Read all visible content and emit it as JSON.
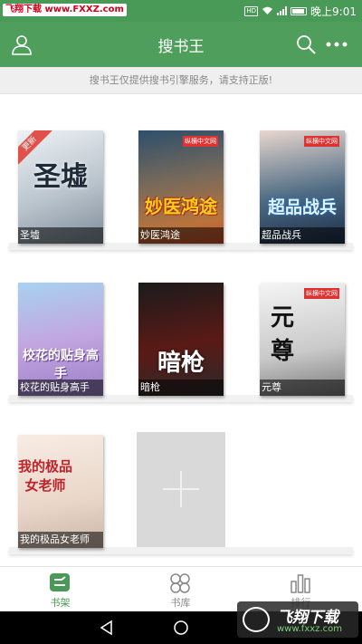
{
  "status_bar": {
    "watermark": "飞翔下载 www.FXXZ.com",
    "network": "HD",
    "time": "晚上9:01"
  },
  "app_bar": {
    "title": "搜书王"
  },
  "notice": "搜书王仅提供搜书引擎服务，请支持正版!",
  "books": [
    {
      "name": "圣墟",
      "cover_text": "圣墟",
      "badge": "更新",
      "bg": "#cfd7dd"
    },
    {
      "name": "妙医鸿途",
      "cover_text": "妙医鸿途",
      "publisher": "纵横中文网",
      "bg": "#8a5a3a"
    },
    {
      "name": "超品战兵",
      "cover_text": "超品战兵",
      "publisher": "纵横中文网",
      "bg": "#3a5c7a"
    },
    {
      "name": "校花的贴身高手",
      "cover_text": "校花的贴身高手",
      "bg": "#b9a2d8"
    },
    {
      "name": "暗枪",
      "cover_text": "暗枪",
      "bg": "#2a2a2a"
    },
    {
      "name": "元尊",
      "cover_text": "元尊",
      "publisher": "纵横中文网",
      "bg": "#e6e6e6"
    },
    {
      "name": "我的极品女老师",
      "cover_text": "我的极品女老师",
      "bg": "#f1e4dc"
    }
  ],
  "bottom_nav": [
    {
      "label": "书架",
      "active": true
    },
    {
      "label": "书库",
      "active": false
    },
    {
      "label": "排行",
      "active": false
    }
  ],
  "watermark_bottom": {
    "title": "飞翔下载",
    "url": "www.fxxz.com"
  },
  "colors": {
    "primary": "#4f9e5b",
    "status": "#4a9a57",
    "notice_bg": "#efefef"
  }
}
